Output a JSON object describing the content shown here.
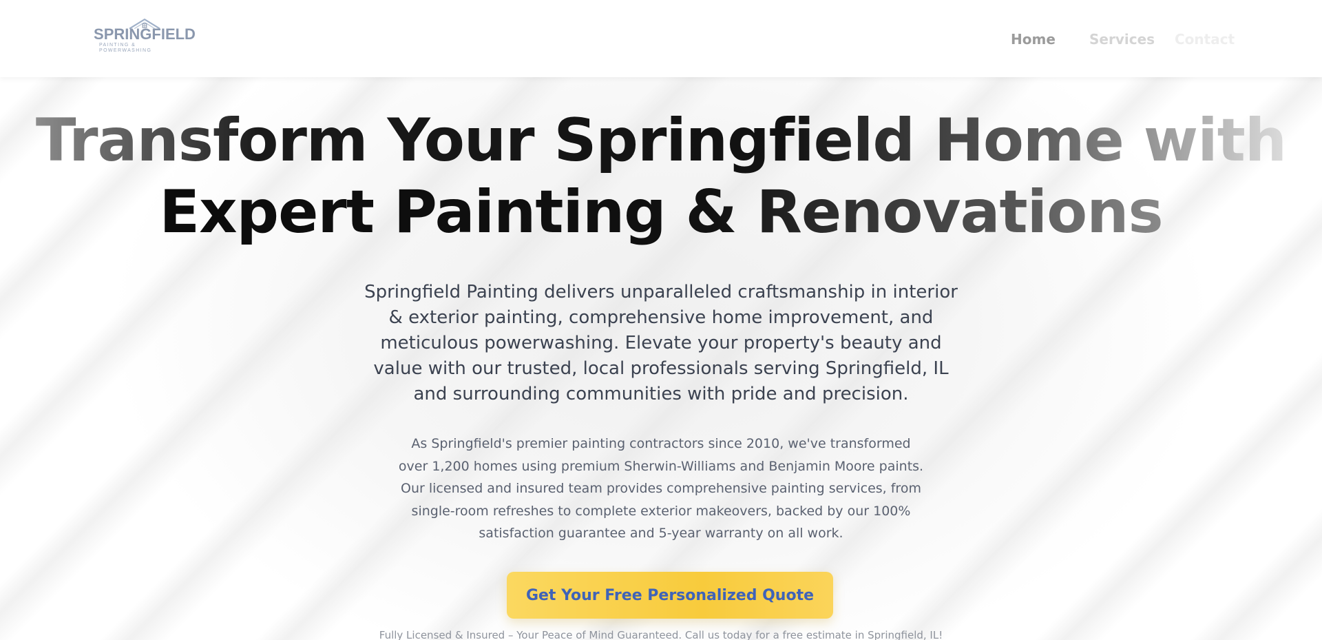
{
  "brand": {
    "name": "SPRINGFIELD",
    "tagline": "PAINTING & POWERWASHING",
    "logo_color": "#8a97ad"
  },
  "nav": {
    "items": [
      {
        "label": "Home"
      },
      {
        "label": "Services"
      },
      {
        "label": "Contact"
      }
    ]
  },
  "hero": {
    "title_line1": "Transform Your Springfield Home with",
    "title_line2": "Expert Painting & Renovations",
    "lead": "Springfield Painting delivers unparalleled craftsmanship in interior & exterior painting, comprehensive home improvement, and meticulous powerwashing. Elevate your property's beauty and value with our trusted, local professionals serving Springfield, IL and surrounding communities with pride and precision.",
    "body": "As Springfield's premier painting contractors since 2010, we've transformed over 1,200 homes using premium Sherwin-Williams and Benjamin Moore paints. Our licensed and insured team provides comprehensive painting services, from single-room refreshes to complete exterior makeovers, backed by our 100% satisfaction guarantee and 5-year warranty on all work.",
    "cta_label": "Get Your Free Personalized Quote",
    "trust_note": "Fully Licensed & Insured – Your Peace of Mind Guaranteed. Call us today for a free estimate in Springfield, IL!"
  },
  "colors": {
    "cta_background": "#f8cb3c",
    "cta_text": "#3f63b8",
    "heading": "#111111",
    "body_text": "#3b4250"
  }
}
